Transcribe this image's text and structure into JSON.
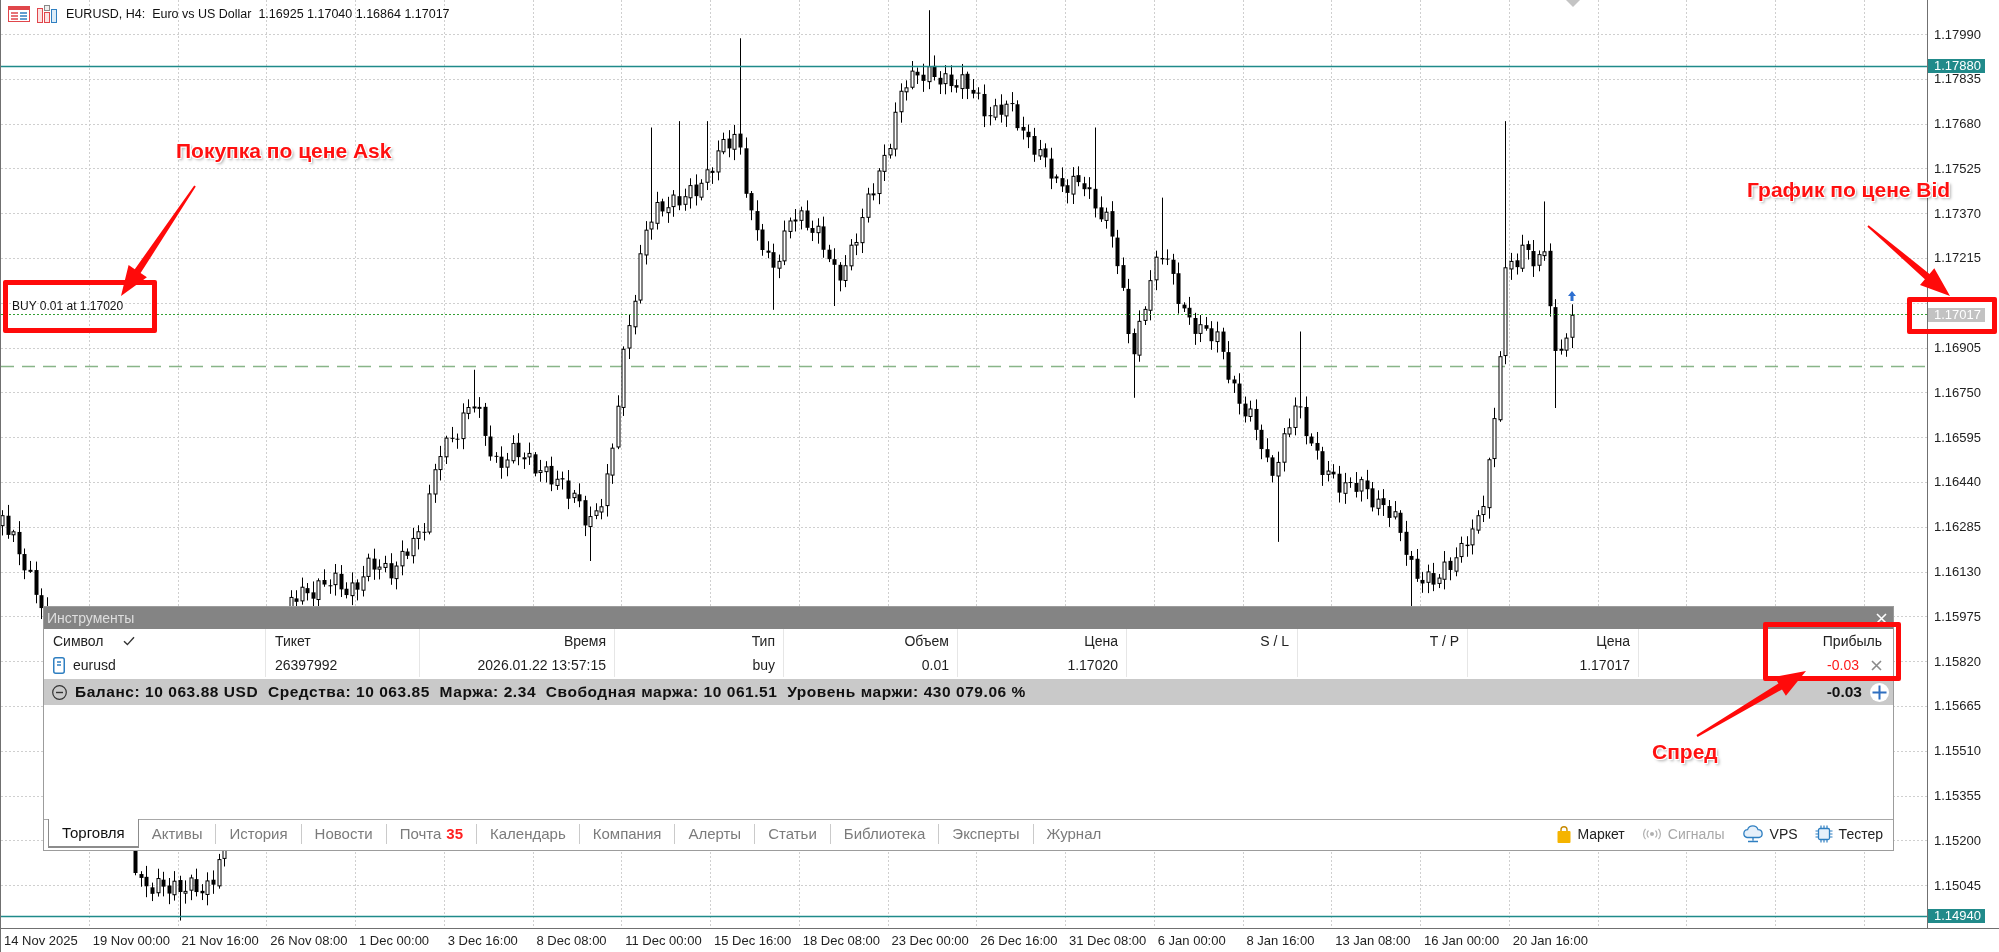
{
  "chart": {
    "title": "EURUSD, H4:  Euro vs US Dollar  1.16925 1.17040 1.16864 1.17017",
    "trade_label": "BUY 0.01 at 1.17020",
    "price_axis": [
      "1.17990",
      "1.17835",
      "1.17680",
      "1.17525",
      "1.17370",
      "1.17215",
      "1.16905",
      "1.16750",
      "1.16595",
      "1.16440",
      "1.16285",
      "1.16130",
      "1.15975",
      "1.15820",
      "1.15665",
      "1.15510",
      "1.15355",
      "1.15200",
      "1.15045"
    ],
    "price_tags": [
      {
        "kind": "line",
        "text": "1.17880"
      },
      {
        "kind": "bid",
        "text": "1.17017"
      },
      {
        "kind": "line",
        "text": "1.14940"
      }
    ],
    "time_axis": [
      "14 Nov 2025",
      "19 Nov 00:00",
      "21 Nov 16:00",
      "26 Nov 08:00",
      "1 Dec 00:00",
      "3 Dec 16:00",
      "8 Dec 08:00",
      "11 Dec 00:00",
      "15 Dec 16:00",
      "18 Dec 08:00",
      "23 Dec 00:00",
      "26 Dec 16:00",
      "31 Dec 08:00",
      "6 Jan 00:00",
      "8 Jan 16:00",
      "13 Jan 08:00",
      "16 Jan 00:00",
      "20 Jan 16:00"
    ]
  },
  "toolbox": {
    "title": "Инструменты",
    "columns": [
      {
        "label": "Символ",
        "checked": true
      },
      {
        "label": "Тикет",
        "checked": false
      },
      {
        "label": "Время",
        "checked": false
      },
      {
        "label": "Тип",
        "checked": false
      },
      {
        "label": "Объем",
        "checked": false
      },
      {
        "label": "Цена",
        "checked": false
      },
      {
        "label": "S / L",
        "checked": false
      },
      {
        "label": "T / P",
        "checked": false
      },
      {
        "label": "Цена",
        "checked": false
      },
      {
        "label": "Прибыль",
        "checked": false
      }
    ],
    "rows": [
      {
        "symbol": "eurusd",
        "ticket": "26397992",
        "time": "2026.01.22 13:57:15",
        "type": "buy",
        "volume": "0.01",
        "open_price": "1.17020",
        "price": "1.17017",
        "profit": "-0.03",
        "loss": true
      }
    ],
    "summary": {
      "expanded": true,
      "text": "Баланс: 10 063.88 USD  Средства: 10 063.85  Маржа: 2.34  Свободная маржа: 10 061.51  Уровень маржи: 430 079.06 %",
      "profit": "-0.03"
    },
    "tabs": [
      {
        "label": "Торговля",
        "selected": true
      },
      {
        "label": "Активы",
        "selected": false
      },
      {
        "label": "История",
        "selected": false
      },
      {
        "label": "Новости",
        "selected": false
      },
      {
        "label": "Почта",
        "selected": false,
        "badge": "35"
      },
      {
        "label": "Календарь",
        "selected": false
      },
      {
        "label": "Компания",
        "selected": false
      },
      {
        "label": "Алерты",
        "selected": false
      },
      {
        "label": "Статьи",
        "selected": false
      },
      {
        "label": "Библиотека",
        "selected": false
      },
      {
        "label": "Эксперты",
        "selected": false
      },
      {
        "label": "Журнал",
        "selected": false
      }
    ],
    "service_tabs": [
      {
        "kind": "market",
        "label": "Маркет",
        "disabled": false
      },
      {
        "kind": "signals",
        "label": "Сигналы",
        "disabled": true
      },
      {
        "kind": "vps",
        "label": "VPS",
        "disabled": false
      },
      {
        "kind": "tester",
        "label": "Тестер",
        "disabled": false
      }
    ]
  },
  "annotations": [
    {
      "text": "Покупка по цене Ask"
    },
    {
      "text": "График по цене Bid"
    },
    {
      "text": "Спред"
    }
  ]
}
